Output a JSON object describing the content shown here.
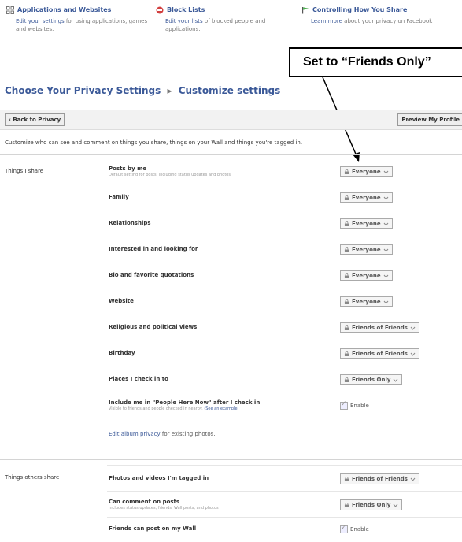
{
  "header_links": [
    {
      "title": "Applications and Websites",
      "link_text": "Edit your settings",
      "desc": "for using applications, games and websites."
    },
    {
      "title": "Block Lists",
      "link_text": "Edit your lists",
      "desc": "of blocked people and applications."
    },
    {
      "title": "Controlling How You Share",
      "link_text": "Learn more",
      "desc": "about your privacy on Facebook"
    }
  ],
  "callout_text": "Set to “Friends Only”",
  "breadcrumb": {
    "root": "Choose Your Privacy Settings",
    "separator": "▸",
    "current": "Customize settings"
  },
  "buttons": {
    "back": "‹ Back to Privacy",
    "preview": "Preview My Profile"
  },
  "description": "Customize who can see and comment on things you share, things on your Wall and things you're tagged in.",
  "sections": {
    "things_i_share": "Things I share",
    "things_others_share": "Things others share"
  },
  "settings_i_share": [
    {
      "label": "Posts by me",
      "hint": "Default setting for posts, including status updates and photos",
      "value": "Everyone"
    },
    {
      "label": "Family",
      "value": "Everyone"
    },
    {
      "label": "Relationships",
      "value": "Everyone"
    },
    {
      "label": "Interested in and looking for",
      "value": "Everyone"
    },
    {
      "label": "Bio and favorite quotations",
      "value": "Everyone"
    },
    {
      "label": "Website",
      "value": "Everyone"
    },
    {
      "label": "Religious and political views",
      "value": "Friends of Friends"
    },
    {
      "label": "Birthday",
      "value": "Friends of Friends"
    },
    {
      "label": "Places I check in to",
      "value": "Friends Only"
    },
    {
      "label": "Include me in \"People Here Now\" after I check in",
      "hint": "Visible to friends and people checked in nearby.",
      "hint_link": "(See an example)",
      "checkbox": "Enable"
    }
  ],
  "album_note": {
    "link": "Edit album privacy",
    "text": "for existing photos."
  },
  "settings_others_share": [
    {
      "label": "Photos and videos I'm tagged in",
      "value": "Friends of Friends"
    },
    {
      "label": "Can comment on posts",
      "hint": "Includes status updates, friends' Wall posts, and photos",
      "value": "Friends Only"
    },
    {
      "label": "Friends can post on my Wall",
      "checkbox": "Enable"
    }
  ],
  "colors": {
    "link": "#3b5998",
    "block_icon": "#d23f3f",
    "flag_icon": "#4caf50"
  }
}
